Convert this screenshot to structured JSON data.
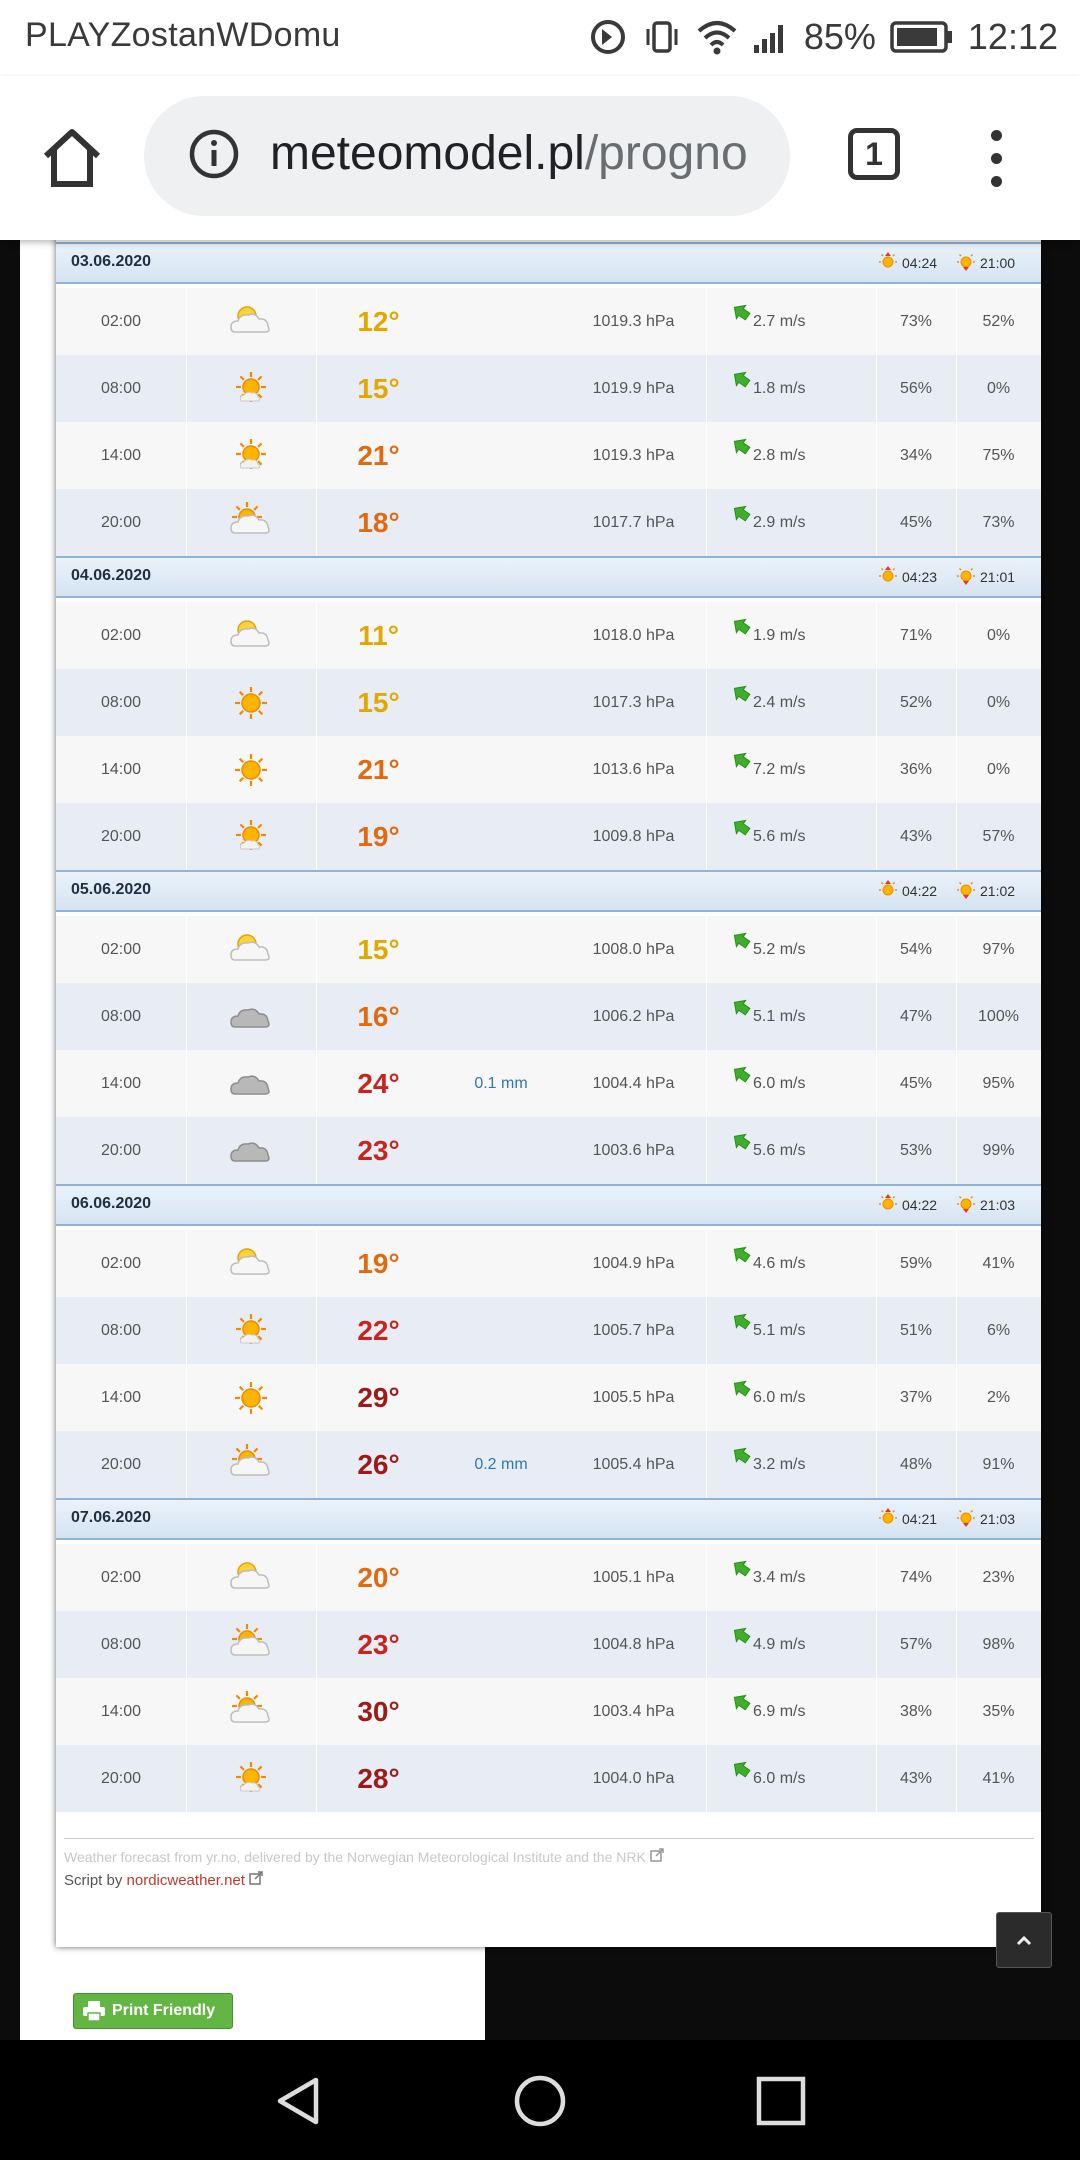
{
  "status_bar": {
    "carrier": "PLAYZostanWDomu",
    "battery": "85%",
    "time": "12:12"
  },
  "browser": {
    "url_host": "meteomodel.pl",
    "url_path": "/progno",
    "tab_count": "1"
  },
  "days": [
    {
      "date": "03.06.2020",
      "sunrise": "04:24",
      "sunset": "21:00",
      "rows": [
        {
          "time": "02:00",
          "icon": "partly-cloudy-night-icon",
          "temp": "12°",
          "precip": "",
          "pressure": "1019.3 hPa",
          "wind": "2.7 m/s",
          "humidity": "73%",
          "cloud": "52%"
        },
        {
          "time": "08:00",
          "icon": "fair-sun-icon",
          "temp": "15°",
          "precip": "",
          "pressure": "1019.9 hPa",
          "wind": "1.8 m/s",
          "humidity": "56%",
          "cloud": "0%"
        },
        {
          "time": "14:00",
          "icon": "fair-sun-icon",
          "temp": "21°",
          "precip": "",
          "pressure": "1019.3 hPa",
          "wind": "2.8 m/s",
          "humidity": "34%",
          "cloud": "75%"
        },
        {
          "time": "20:00",
          "icon": "partly-cloudy-day-icon",
          "temp": "18°",
          "precip": "",
          "pressure": "1017.7 hPa",
          "wind": "2.9 m/s",
          "humidity": "45%",
          "cloud": "73%"
        }
      ]
    },
    {
      "date": "04.06.2020",
      "sunrise": "04:23",
      "sunset": "21:01",
      "rows": [
        {
          "time": "02:00",
          "icon": "partly-cloudy-night-icon",
          "temp": "11°",
          "precip": "",
          "pressure": "1018.0 hPa",
          "wind": "1.9 m/s",
          "humidity": "71%",
          "cloud": "0%"
        },
        {
          "time": "08:00",
          "icon": "clear-sun-icon",
          "temp": "15°",
          "precip": "",
          "pressure": "1017.3 hPa",
          "wind": "2.4 m/s",
          "humidity": "52%",
          "cloud": "0%"
        },
        {
          "time": "14:00",
          "icon": "clear-sun-icon",
          "temp": "21°",
          "precip": "",
          "pressure": "1013.6 hPa",
          "wind": "7.2 m/s",
          "humidity": "36%",
          "cloud": "0%"
        },
        {
          "time": "20:00",
          "icon": "fair-sun-icon",
          "temp": "19°",
          "precip": "",
          "pressure": "1009.8 hPa",
          "wind": "5.6 m/s",
          "humidity": "43%",
          "cloud": "57%"
        }
      ]
    },
    {
      "date": "05.06.2020",
      "sunrise": "04:22",
      "sunset": "21:02",
      "rows": [
        {
          "time": "02:00",
          "icon": "partly-cloudy-night-icon",
          "temp": "15°",
          "precip": "",
          "pressure": "1008.0 hPa",
          "wind": "5.2 m/s",
          "humidity": "54%",
          "cloud": "97%"
        },
        {
          "time": "08:00",
          "icon": "cloud-icon",
          "temp": "16°",
          "precip": "",
          "pressure": "1006.2 hPa",
          "wind": "5.1 m/s",
          "humidity": "47%",
          "cloud": "100%"
        },
        {
          "time": "14:00",
          "icon": "cloud-icon",
          "temp": "24°",
          "precip": "0.1 mm",
          "pressure": "1004.4 hPa",
          "wind": "6.0 m/s",
          "humidity": "45%",
          "cloud": "95%"
        },
        {
          "time": "20:00",
          "icon": "cloud-icon",
          "temp": "23°",
          "precip": "",
          "pressure": "1003.6 hPa",
          "wind": "5.6 m/s",
          "humidity": "53%",
          "cloud": "99%"
        }
      ]
    },
    {
      "date": "06.06.2020",
      "sunrise": "04:22",
      "sunset": "21:03",
      "rows": [
        {
          "time": "02:00",
          "icon": "partly-cloudy-night-icon",
          "temp": "19°",
          "precip": "",
          "pressure": "1004.9 hPa",
          "wind": "4.6 m/s",
          "humidity": "59%",
          "cloud": "41%"
        },
        {
          "time": "08:00",
          "icon": "fair-sun-icon",
          "temp": "22°",
          "precip": "",
          "pressure": "1005.7 hPa",
          "wind": "5.1 m/s",
          "humidity": "51%",
          "cloud": "6%"
        },
        {
          "time": "14:00",
          "icon": "clear-sun-icon",
          "temp": "29°",
          "precip": "",
          "pressure": "1005.5 hPa",
          "wind": "6.0 m/s",
          "humidity": "37%",
          "cloud": "2%"
        },
        {
          "time": "20:00",
          "icon": "partly-cloudy-day-icon",
          "temp": "26°",
          "precip": "0.2 mm",
          "pressure": "1005.4 hPa",
          "wind": "3.2 m/s",
          "humidity": "48%",
          "cloud": "91%"
        }
      ]
    },
    {
      "date": "07.06.2020",
      "sunrise": "04:21",
      "sunset": "21:03",
      "rows": [
        {
          "time": "02:00",
          "icon": "partly-cloudy-night-icon",
          "temp": "20°",
          "precip": "",
          "pressure": "1005.1 hPa",
          "wind": "3.4 m/s",
          "humidity": "74%",
          "cloud": "23%"
        },
        {
          "time": "08:00",
          "icon": "partly-cloudy-day-icon",
          "temp": "23°",
          "precip": "",
          "pressure": "1004.8 hPa",
          "wind": "4.9 m/s",
          "humidity": "57%",
          "cloud": "98%"
        },
        {
          "time": "14:00",
          "icon": "partly-cloudy-day-icon",
          "temp": "30°",
          "precip": "",
          "pressure": "1003.4 hPa",
          "wind": "6.9 m/s",
          "humidity": "38%",
          "cloud": "35%"
        },
        {
          "time": "20:00",
          "icon": "fair-sun-icon",
          "temp": "28°",
          "precip": "",
          "pressure": "1004.0 hPa",
          "wind": "6.0 m/s",
          "humidity": "43%",
          "cloud": "41%"
        }
      ]
    }
  ],
  "footer": {
    "credit": "Weather forecast from yr.no, delivered by the Norwegian Meteorological Institute and the NRK",
    "script_prefix": "Script by ",
    "script_link": "nordicweather.net"
  },
  "print_button": "Print Friendly",
  "colors": {
    "temp_cool": "#e0a800",
    "temp_mild": "#e06a10",
    "temp_warm": "#c8241e",
    "temp_hot": "#9e1a1a",
    "wind_arrow": "#3fae2a",
    "header_border": "#8fb4d6"
  }
}
